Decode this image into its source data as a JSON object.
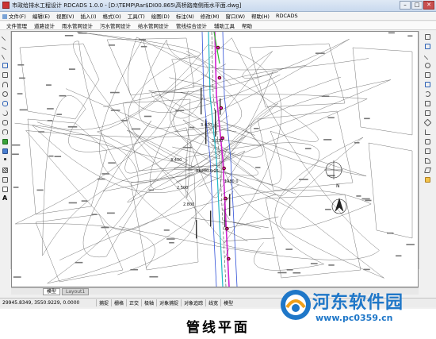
{
  "window": {
    "title": "市政给排水工程设计 RDCADS 1.0.0 - [D:\\TEMP\\Rar$DI00.865\\高桥路南侧雨水平面.dwg]",
    "min": "–",
    "max": "□",
    "close": "✕"
  },
  "menu": [
    "文件(F)",
    "编辑(E)",
    "视图(V)",
    "插入(I)",
    "格式(O)",
    "工具(T)",
    "绘图(D)",
    "标注(N)",
    "修改(M)",
    "窗口(W)",
    "帮助(H)",
    "RDCADS"
  ],
  "ribbon": [
    "文件管理",
    "道路设计",
    "雨水管网设计",
    "污水管网设计",
    "给水管网设计",
    "管线综合设计",
    "辅助工具",
    "帮助"
  ],
  "drawing": {
    "labels": [
      "3.400",
      "2.500",
      "2.800",
      "XK200,0.25",
      "1980.0",
      "3.470",
      "3.030",
      "N"
    ]
  },
  "tabs": [
    "模型",
    "Layout1"
  ],
  "status": {
    "coords": "29945.8349, 3550.9229, 0.0000",
    "toggles": [
      "捕捉",
      "栅格",
      "正交",
      "极轴",
      "对象捕捉",
      "对象追踪",
      "线宽",
      "模型"
    ]
  },
  "caption": "管线平面",
  "watermark": {
    "title": "河东软件园",
    "url": "www.pc0359.cn"
  },
  "colors": {
    "pipe_magenta": "#d020d0",
    "pipe_cyan": "#20b8c8",
    "road_blue": "#3050d8",
    "logo_blue": "#1f77c8"
  }
}
